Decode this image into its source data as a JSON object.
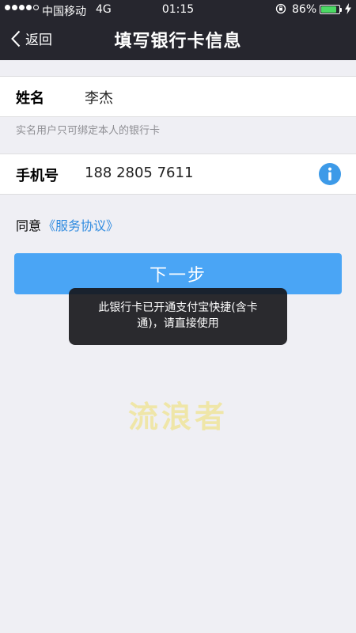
{
  "status_bar": {
    "carrier": "中国移动",
    "network": "4G",
    "time": "01:15",
    "battery_percent": "86%",
    "battery_level": 0.86
  },
  "nav": {
    "back_label": "返回",
    "title": "填写银行卡信息"
  },
  "form": {
    "name": {
      "label": "姓名",
      "value": "李杰"
    },
    "name_hint": "实名用户只可绑定本人的银行卡",
    "phone": {
      "label": "手机号",
      "value": "188 2805 7611"
    }
  },
  "agreement": {
    "prefix": "同意",
    "link": "《服务协议》"
  },
  "next_button": "下一步",
  "toast": "此银行卡已开通支付宝快捷(含卡通)，请直接使用",
  "watermark": "流浪者",
  "colors": {
    "nav_bg": "#26262e",
    "accent": "#4aa5f5",
    "link": "#2f8be0",
    "page_bg": "#efeff4"
  }
}
